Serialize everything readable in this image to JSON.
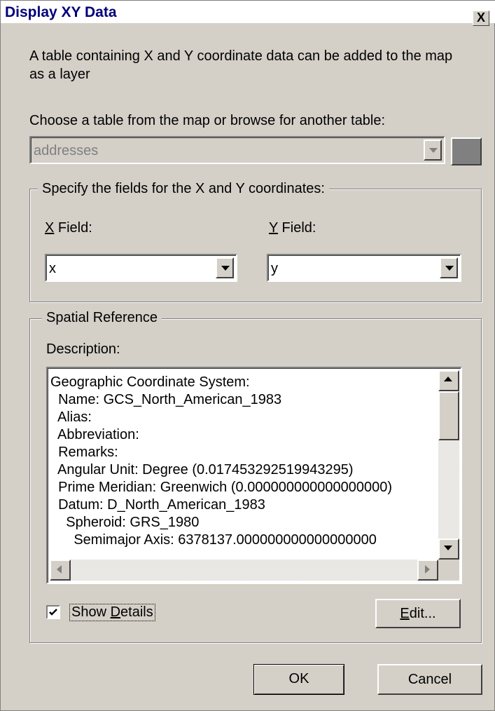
{
  "window": {
    "title": "Display XY Data",
    "close_symbol": "X"
  },
  "intro_text": "A table containing X and Y coordinate data can be added to the map as a layer",
  "table_prompt": "Choose a table from the map or browse for another table:",
  "table_select": {
    "value": "addresses"
  },
  "fields_group": {
    "legend": "Specify the fields for the X and Y coordinates:",
    "x_label_key": "X",
    "x_label_rest": " Field:",
    "y_label_key": "Y",
    "y_label_rest": " Field:",
    "x_value": "x",
    "y_value": "y"
  },
  "spatial_group": {
    "legend": "Spatial Reference",
    "description_label": "Description:",
    "description_lines": [
      "Geographic Coordinate System:",
      "  Name: GCS_North_American_1983",
      "  Alias:",
      "  Abbreviation:",
      "  Remarks:",
      "  Angular Unit: Degree (0.017453292519943295)",
      "  Prime Meridian: Greenwich (0.000000000000000000)",
      "  Datum: D_North_American_1983",
      "    Spheroid: GRS_1980",
      "      Semimajor Axis: 6378137.000000000000000000"
    ],
    "show_details": {
      "checked": true,
      "label_pre": "Show ",
      "label_key": "D",
      "label_post": "etails"
    },
    "edit_button": {
      "key": "E",
      "rest": "dit..."
    }
  },
  "buttons": {
    "ok": "OK",
    "cancel": "Cancel"
  }
}
